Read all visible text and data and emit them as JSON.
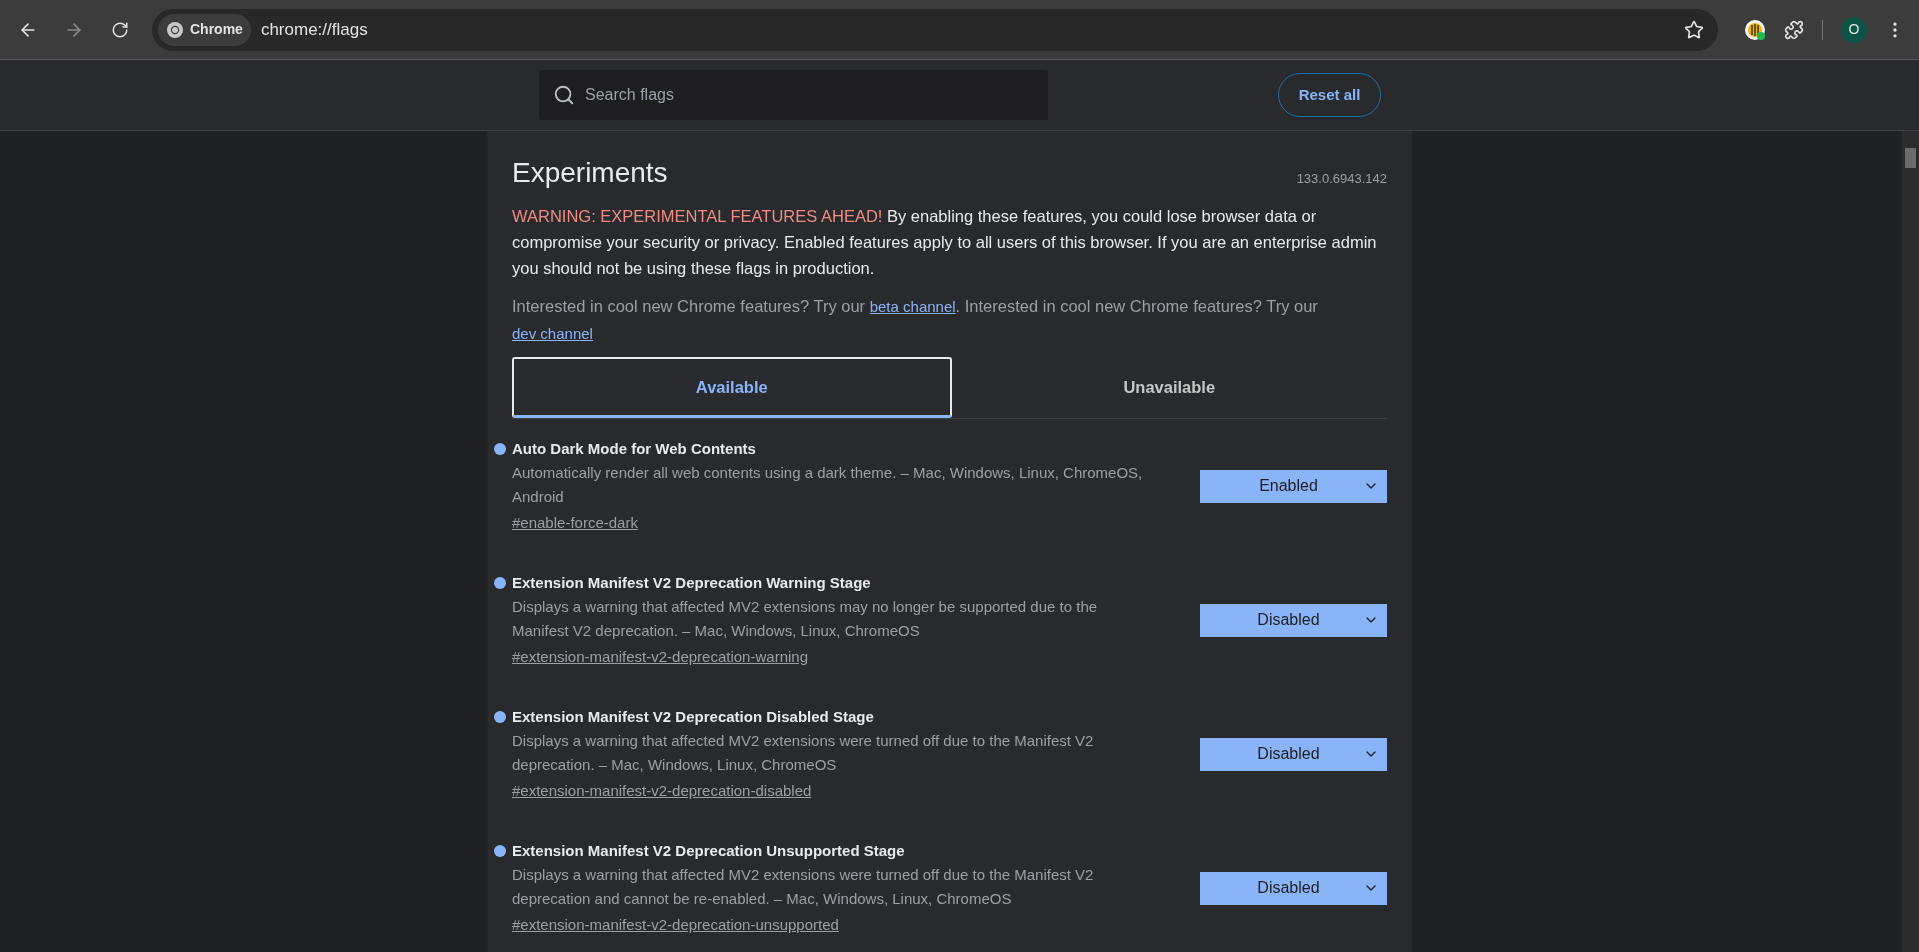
{
  "browser": {
    "site_chip": "Chrome",
    "url": "chrome://flags",
    "avatar": "O"
  },
  "header": {
    "search": {
      "placeholder": "Search flags"
    },
    "reset_button": "Reset all"
  },
  "title": "Experiments",
  "version": "133.0.6943.142",
  "warning": [
    {
      "kind": "alert",
      "text": "WARNING: EXPERIMENTAL FEATURES AHEAD!"
    },
    {
      "kind": "text",
      "text": " By enabling these features, you could lose browser data or compromise your security or privacy. Enabled features apply to all users of this browser. If you are an enterprise admin you should not be using these flags in production."
    }
  ],
  "promo": [
    {
      "kind": "text",
      "text": "Interested in cool new Chrome features? Try our "
    },
    {
      "kind": "link",
      "text": "beta channel"
    },
    {
      "kind": "text",
      "text": ". Interested in cool new Chrome features? Try our "
    },
    {
      "kind": "link",
      "text": "dev channel"
    }
  ],
  "tabs": [
    {
      "label": "Available",
      "selected": true
    },
    {
      "label": "Unavailable",
      "selected": false
    }
  ],
  "flags": [
    {
      "title": "Auto Dark Mode for Web Contents",
      "modified": true,
      "description": "Automatically render all web contents using a dark theme. – Mac, Windows, Linux, ChromeOS, Android",
      "link": "#enable-force-dark",
      "value": "Enabled"
    },
    {
      "title": "Extension Manifest V2 Deprecation Warning Stage",
      "modified": true,
      "description": "Displays a warning that affected MV2 extensions may no longer be supported due to the Manifest V2 deprecation. – Mac, Windows, Linux, ChromeOS",
      "link": "#extension-manifest-v2-deprecation-warning",
      "value": "Disabled"
    },
    {
      "title": "Extension Manifest V2 Deprecation Disabled Stage",
      "modified": true,
      "description": "Displays a warning that affected MV2 extensions were turned off due to the Manifest V2 deprecation. – Mac, Windows, Linux, ChromeOS",
      "link": "#extension-manifest-v2-deprecation-disabled",
      "value": "Disabled"
    },
    {
      "title": "Extension Manifest V2 Deprecation Unsupported Stage",
      "modified": true,
      "description": "Displays a warning that affected MV2 extensions were turned off due to the Manifest V2 deprecation and cannot be re-enabled. – Mac, Windows, Linux, ChromeOS",
      "link": "#extension-manifest-v2-deprecation-unsupported",
      "value": "Disabled"
    }
  ]
}
